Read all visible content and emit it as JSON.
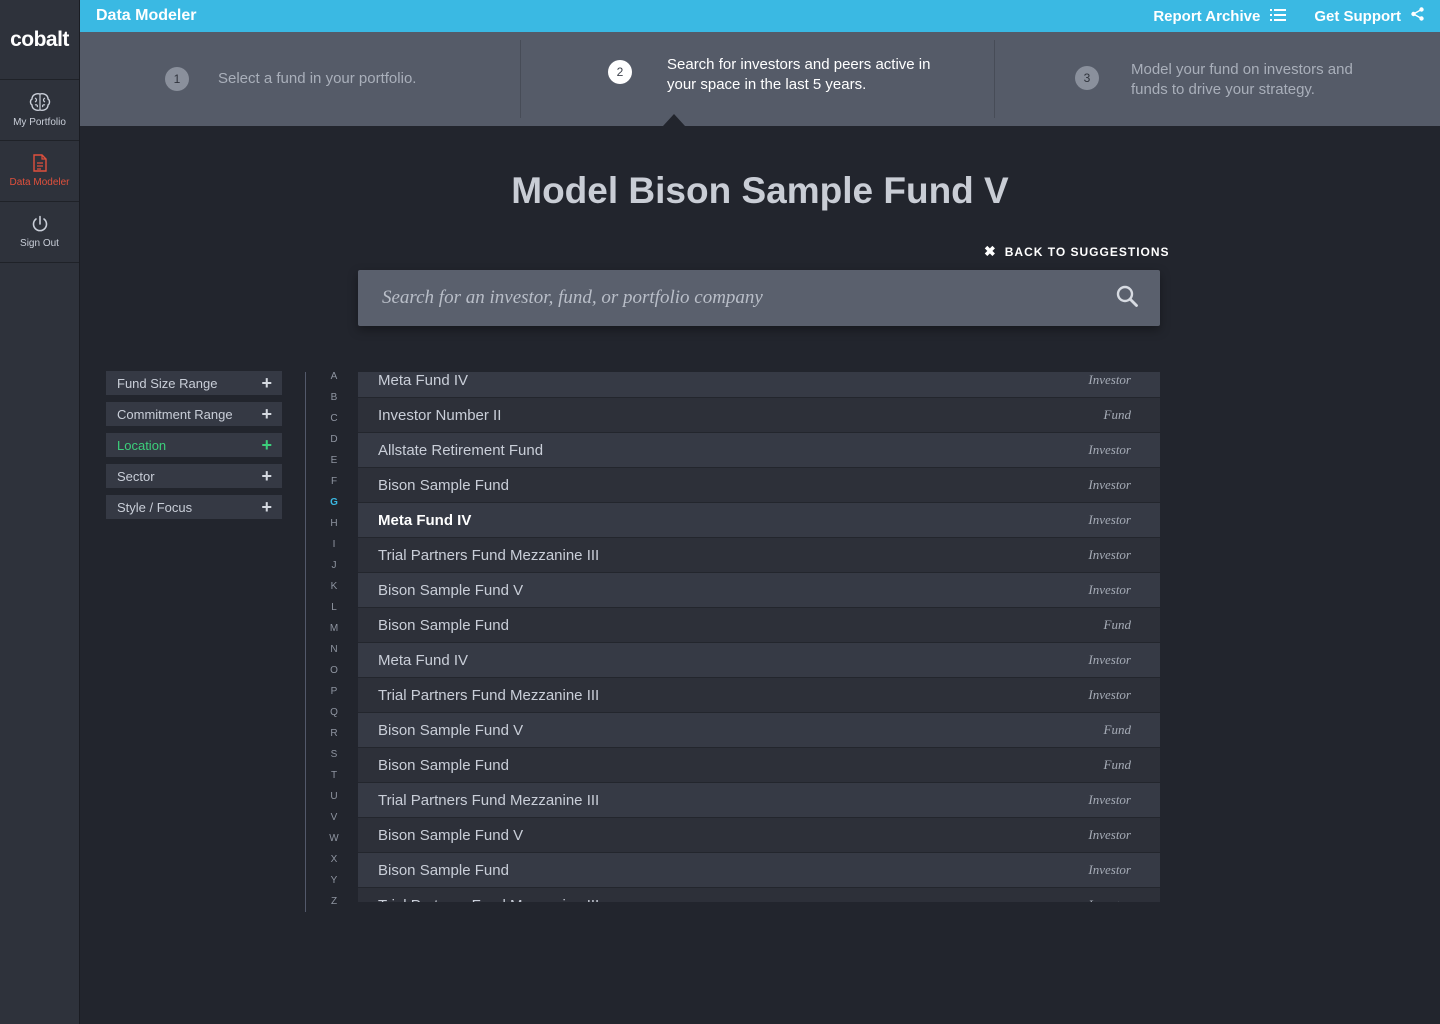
{
  "sidebar": {
    "logo": "cobalt",
    "items": [
      {
        "label": "My Portfolio",
        "icon": "brain-icon",
        "active": false
      },
      {
        "label": "Data Modeler",
        "icon": "document-icon",
        "active": true
      },
      {
        "label": "Sign Out",
        "icon": "power-icon",
        "active": false
      }
    ]
  },
  "topbar": {
    "title": "Data Modeler",
    "report_archive": "Report Archive",
    "get_support": "Get Support"
  },
  "steps": [
    {
      "num": "1",
      "text": "Select a fund in your portfolio.",
      "active": false
    },
    {
      "num": "2",
      "text": "Search for investors and peers active in your space in the last 5 years.",
      "active": true
    },
    {
      "num": "3",
      "text": "Model your fund on investors and funds to drive your strategy.",
      "active": false
    }
  ],
  "main": {
    "title": "Model Bison Sample Fund V",
    "back_link": "BACK TO SUGGESTIONS",
    "search_placeholder": "Search for an investor, fund, or portfolio company"
  },
  "filters": [
    {
      "label": "Fund Size Range",
      "active": false
    },
    {
      "label": "Commitment Range",
      "active": false
    },
    {
      "label": "Location",
      "active": true
    },
    {
      "label": "Sector",
      "active": false
    },
    {
      "label": "Style / Focus",
      "active": false
    }
  ],
  "alphabet": [
    "A",
    "B",
    "C",
    "D",
    "E",
    "F",
    "G",
    "H",
    "I",
    "J",
    "K",
    "L",
    "M",
    "N",
    "O",
    "P",
    "Q",
    "R",
    "S",
    "T",
    "U",
    "V",
    "W",
    "X",
    "Y",
    "Z"
  ],
  "alphabet_active": "G",
  "results": [
    {
      "name": "Meta Fund IV",
      "type": "Investor"
    },
    {
      "name": "Investor Number II",
      "type": "Fund"
    },
    {
      "name": "Allstate Retirement Fund",
      "type": "Investor"
    },
    {
      "name": "Bison Sample Fund",
      "type": "Investor"
    },
    {
      "name": "Meta Fund IV",
      "type": "Investor",
      "selected": true
    },
    {
      "name": "Trial Partners Fund Mezzanine III",
      "type": "Investor"
    },
    {
      "name": "Bison Sample Fund V",
      "type": "Investor"
    },
    {
      "name": "Bison Sample Fund",
      "type": "Fund"
    },
    {
      "name": "Meta Fund IV",
      "type": "Investor"
    },
    {
      "name": "Trial Partners Fund Mezzanine III",
      "type": "Investor"
    },
    {
      "name": "Bison Sample Fund V",
      "type": "Fund"
    },
    {
      "name": "Bison Sample Fund",
      "type": "Fund"
    },
    {
      "name": "Trial Partners Fund Mezzanine III",
      "type": "Investor"
    },
    {
      "name": "Bison Sample Fund V",
      "type": "Investor"
    },
    {
      "name": "Bison Sample Fund",
      "type": "Investor"
    },
    {
      "name": "Trial Partners Fund Mezzanine III",
      "type": "Investor"
    }
  ],
  "colors": {
    "accent": "#3ab9e3",
    "active_nav": "#e0503c",
    "active_filter": "#3ccf7b"
  }
}
